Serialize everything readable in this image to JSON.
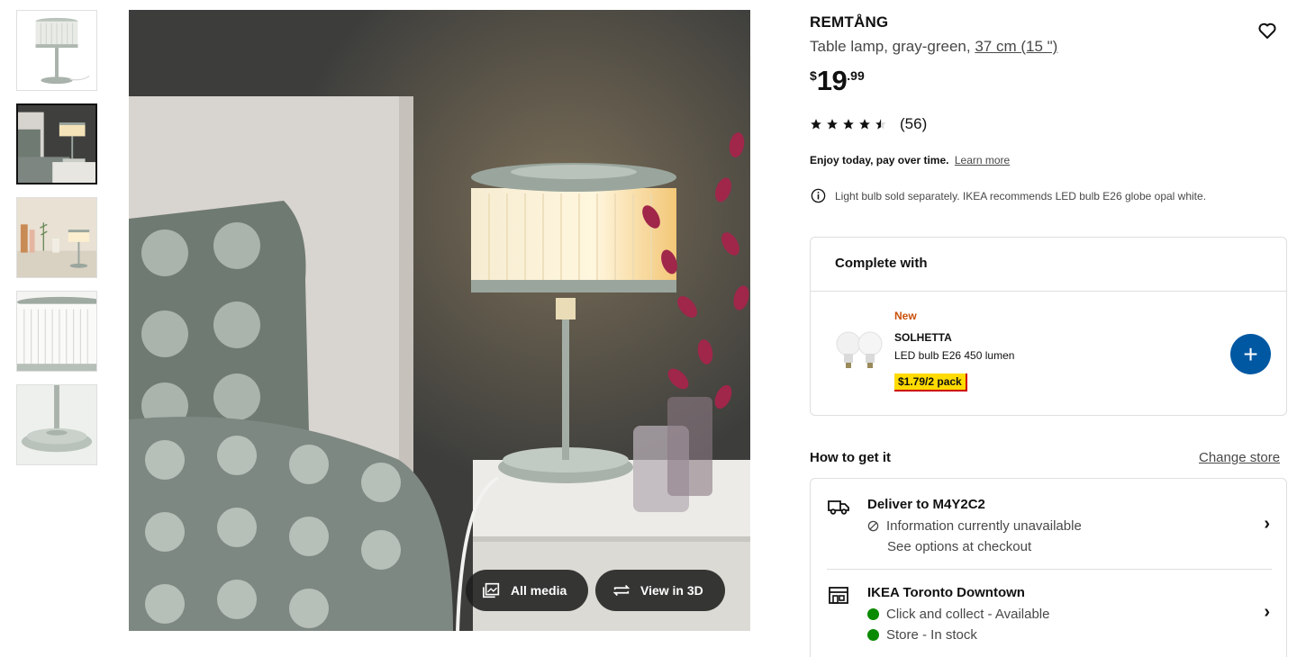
{
  "gallery": {
    "thumbnails": [
      {
        "icon": "lamp-product-thumbnail"
      },
      {
        "icon": "lamp-bedroom-thumbnail",
        "active": true
      },
      {
        "icon": "lamp-shelf-thumbnail"
      },
      {
        "icon": "lamp-shade-closeup-thumbnail"
      },
      {
        "icon": "lamp-base-closeup-thumbnail"
      }
    ],
    "buttons": {
      "all_media": "All media",
      "view_3d": "View in 3D"
    }
  },
  "product": {
    "name": "REMTÅNG",
    "description": "Table lamp, gray-green,",
    "size_link": "37 cm (15 \")",
    "price": {
      "currency": "$",
      "integer": "19",
      "decimal": ".99"
    },
    "rating": {
      "stars": 4.5,
      "count": "(56)"
    },
    "pay_over_time": {
      "bold": "Enjoy today, pay over time.",
      "link": "Learn more"
    },
    "bulb_note": "Light bulb sold separately. IKEA recommends LED bulb E26 globe opal white."
  },
  "complete_with": {
    "heading": "Complete with",
    "item": {
      "tag": "New",
      "name": "SOLHETTA",
      "description": "LED bulb E26 450 lumen",
      "price": "$1.79/2 pack"
    },
    "add_label": "+"
  },
  "availability": {
    "heading": "How to get it",
    "change_store": "Change store",
    "delivery": {
      "title": "Deliver to M4Y2C2",
      "line1": "Information currently unavailable",
      "line2": "See options at checkout"
    },
    "store": {
      "title": "IKEA Toronto Downtown",
      "line1": "Click and collect - Available",
      "line2": "Store - In stock"
    },
    "status_color": "#0a8a00"
  },
  "colors": {
    "accent": "#0058a3",
    "price_tag": "#ffdb00",
    "new_tag": "#ca5008"
  }
}
